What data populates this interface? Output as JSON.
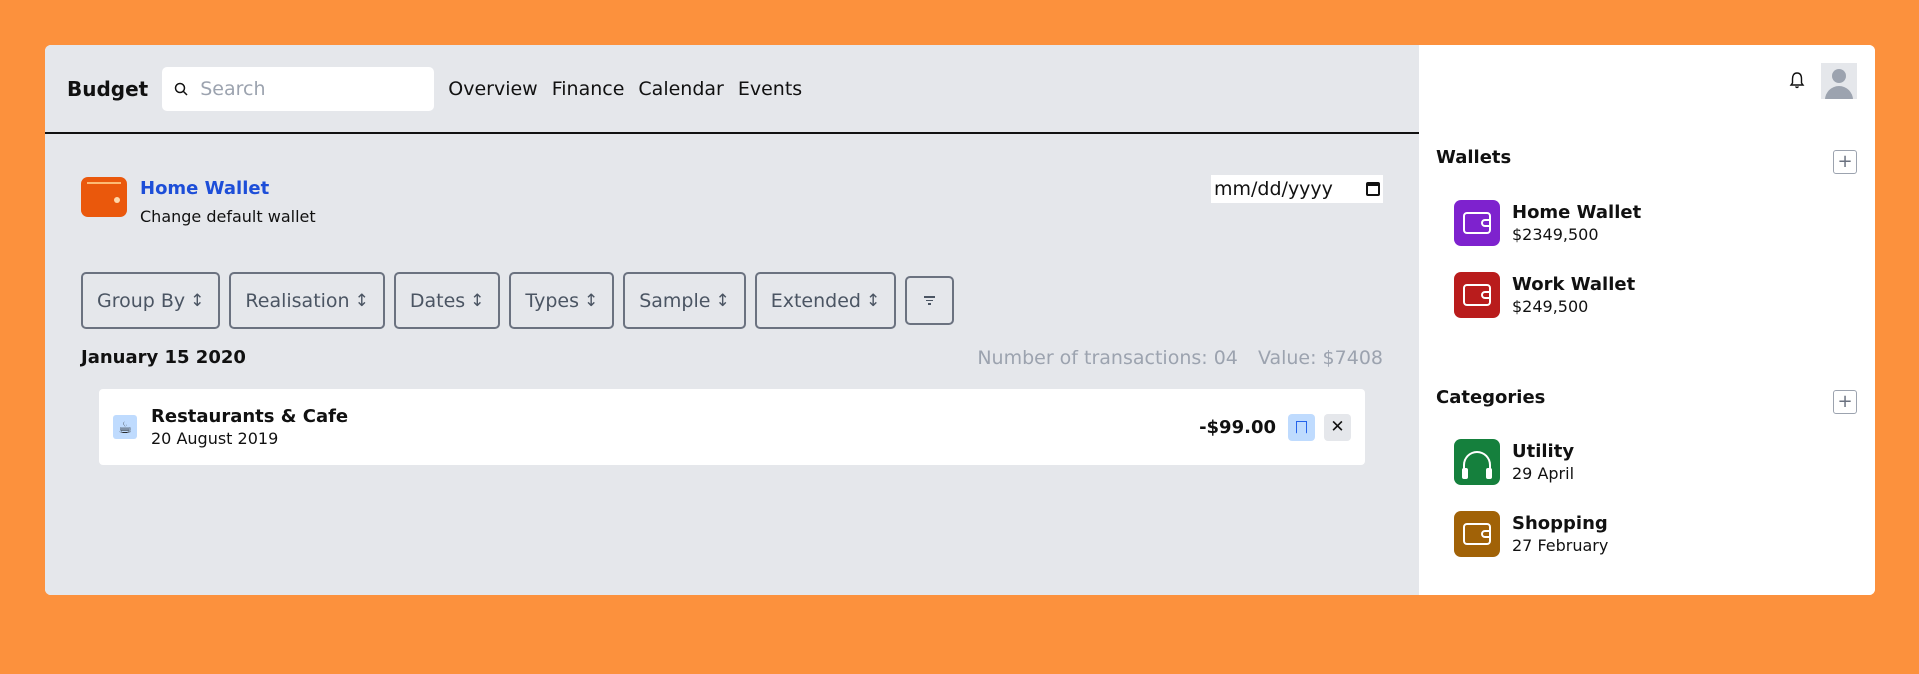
{
  "header": {
    "brand": "Budget",
    "search_placeholder": "Search",
    "nav": [
      "Overview",
      "Finance",
      "Calendar",
      "Events"
    ]
  },
  "wallet": {
    "title": "Home Wallet",
    "subtitle": "Change default wallet",
    "date_placeholder": "mm/dd/yyyy",
    "icon": "wallet-icon",
    "color": "#ea580c"
  },
  "filters": [
    "Group By",
    "Realisation",
    "Dates",
    "Types",
    "Sample",
    "Extended"
  ],
  "day": {
    "heading": "January 15 2020",
    "count_label": "Number of transactions: 04",
    "value_label": "Value: $7408"
  },
  "transaction": {
    "title": "Restaurants & Cafe",
    "date": "20 August 2019",
    "amount": "-$99.00",
    "icon": "coffee-cup-icon"
  },
  "sidebar": {
    "wallets_title": "Wallets",
    "wallets": [
      {
        "name": "Home Wallet",
        "value": "$2349,500",
        "color": "#7e22ce",
        "icon": "wallet-icon"
      },
      {
        "name": "Work Wallet",
        "value": "$249,500",
        "color": "#b91c1c",
        "icon": "wallet-icon"
      }
    ],
    "categories_title": "Categories",
    "categories": [
      {
        "name": "Utility",
        "value": "29 April",
        "color": "#15803d",
        "icon": "headphones-icon"
      },
      {
        "name": "Shopping",
        "value": "27 February",
        "color": "#a16207",
        "icon": "wallet-icon"
      }
    ]
  },
  "colors": {
    "background": "#fc913d",
    "link": "#1d4ed8"
  }
}
